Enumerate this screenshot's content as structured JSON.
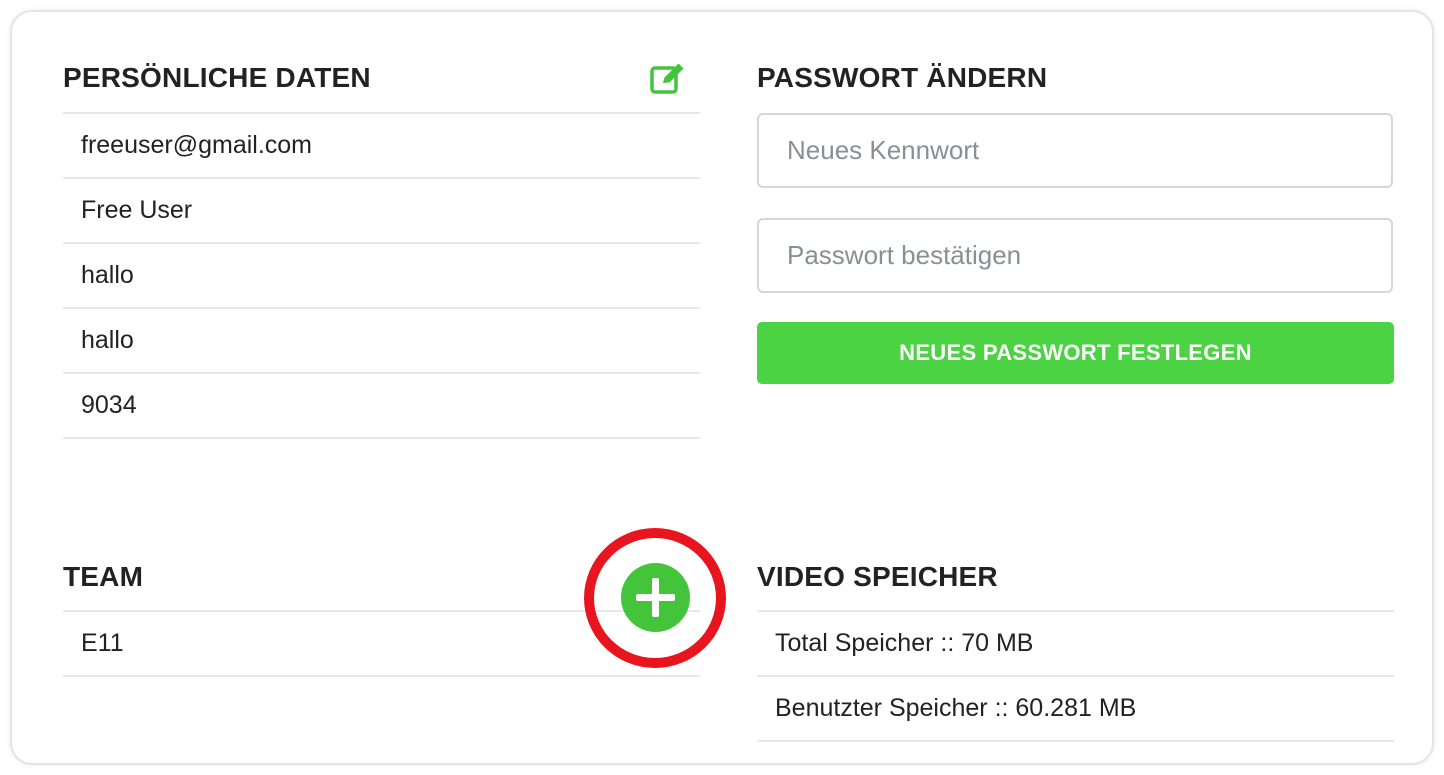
{
  "personal": {
    "title": "PERSÖNLICHE DATEN",
    "edit_icon": "edit-square-pen-icon",
    "rows": [
      "freeuser@gmail.com",
      "Free User",
      "hallo",
      "hallo",
      "9034"
    ]
  },
  "password": {
    "title": "PASSWORT ÄNDERN",
    "new_password": {
      "value": "",
      "placeholder": "Neues Kennwort"
    },
    "confirm_password": {
      "value": "",
      "placeholder": "Passwort bestätigen"
    },
    "submit_label": "NEUES PASSWORT FESTLEGEN"
  },
  "team": {
    "title": "TEAM",
    "add_icon": "plus-circle-icon",
    "rows": [
      "E11"
    ]
  },
  "storage": {
    "title": "VIDEO SPEICHER",
    "rows": [
      "Total Speicher :: 70 MB",
      "Benutzter Speicher :: 60.281 MB"
    ]
  },
  "colors": {
    "accent_green": "#4cd344",
    "highlight_red": "#e8141e",
    "text": "#222222",
    "divider": "#e8e8e8"
  }
}
